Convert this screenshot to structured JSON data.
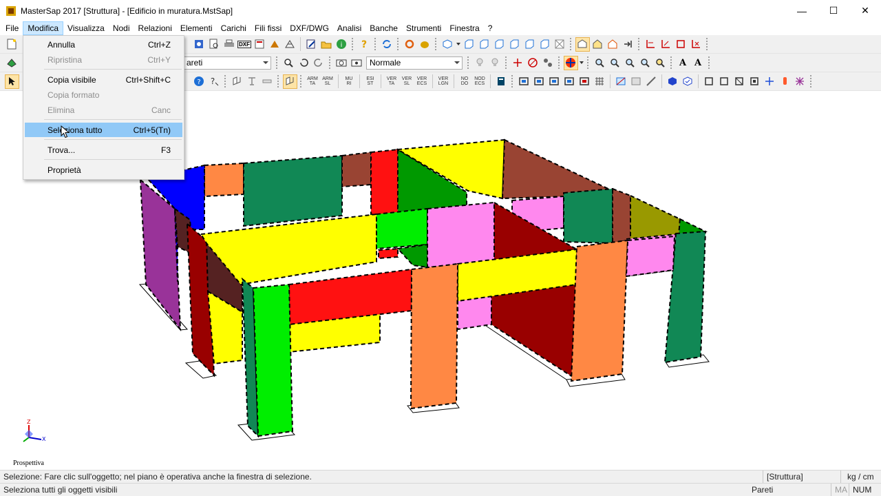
{
  "window": {
    "title": "MasterSap 2017 [Struttura] - [Edificio in muratura.MstSap]",
    "minimize": "—",
    "maximize": "☐",
    "close": "✕"
  },
  "menubar": {
    "items": [
      "File",
      "Modifica",
      "Visualizza",
      "Nodi",
      "Relazioni",
      "Elementi",
      "Carichi",
      "Fili fissi",
      "DXF/DWG",
      "Analisi",
      "Banche",
      "Strumenti",
      "Finestra",
      "?"
    ]
  },
  "toolbar": {
    "combo_element": "areti",
    "combo_mode": "Normale",
    "small_labels": [
      [
        "ARM",
        "TA"
      ],
      [
        "ARM",
        "SL"
      ],
      [
        "MU",
        "RI"
      ],
      [
        "ESI",
        "ST"
      ],
      [
        "VER",
        "TA"
      ],
      [
        "VER",
        "SL"
      ],
      [
        "VER",
        "ECS"
      ],
      [
        "VER",
        "LGN"
      ],
      [
        "NO",
        "DO"
      ],
      [
        "NOD",
        "ECS"
      ]
    ]
  },
  "dropdown": {
    "items": [
      {
        "label": "Annulla",
        "shortcut": "Ctrl+Z",
        "state": "enabled"
      },
      {
        "label": "Ripristina",
        "shortcut": "Ctrl+Y",
        "state": "disabled"
      },
      {
        "label": "Copia visibile",
        "shortcut": "Ctrl+Shift+C",
        "state": "enabled"
      },
      {
        "label": "Copia formato",
        "shortcut": "",
        "state": "disabled"
      },
      {
        "label": "Elimina",
        "shortcut": "Canc",
        "state": "disabled"
      },
      {
        "label": "Seleziona tutto",
        "shortcut": "Ctrl+5(Tn)",
        "state": "hover"
      },
      {
        "label": "Trova...",
        "shortcut": "F3",
        "state": "enabled"
      },
      {
        "label": "Proprietà",
        "shortcut": "",
        "state": "enabled"
      }
    ]
  },
  "viewport": {
    "label": "Prospettiva",
    "axis_label": "Z",
    "axis_x_label": "X"
  },
  "status": {
    "hint": "Selezione: Fare clic sull'oggetto; nel piano è operativa anche la finestra di selezione.",
    "context": "[Struttura]",
    "units": "kg / cm",
    "description": "Seleziona tutti gli oggetti visibili",
    "element_type": "Pareti",
    "ma": "MA",
    "num": "NUM"
  },
  "colors": {
    "yellow": "#ffff00",
    "red": "#ff1111",
    "dark_red": "#990000",
    "green": "#00ee00",
    "dark_green": "#009900",
    "teal_green": "#118855",
    "pink": "#ff88ee",
    "orange": "#ff8844",
    "brown": "#994433",
    "purple": "#993399",
    "blue": "#0000ff",
    "olive": "#999900",
    "dark_brown": "#552222",
    "menu_hover": "#91c9f7"
  }
}
